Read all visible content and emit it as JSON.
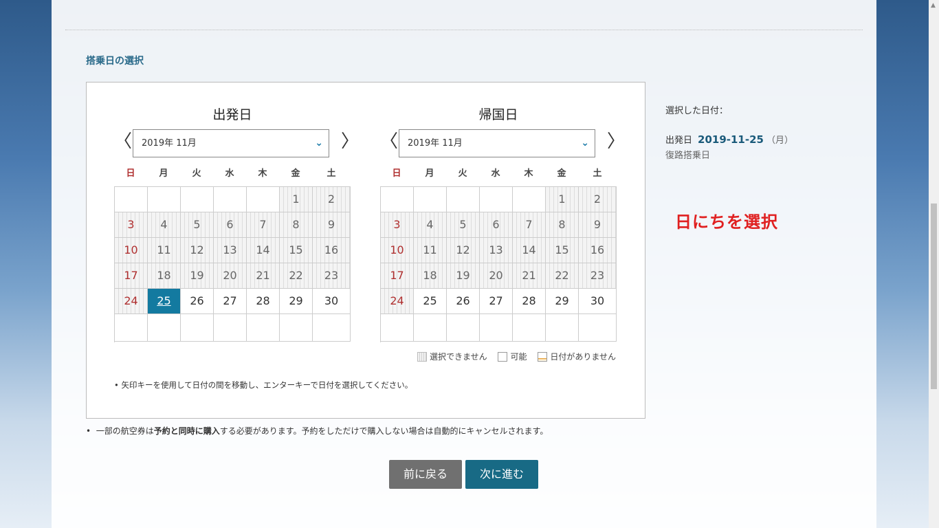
{
  "section_title": "搭乗日の選択",
  "calendars": [
    {
      "title": "出発日",
      "month_value": "2019年 11月",
      "days": [
        {
          "d": "",
          "s": "empty"
        },
        {
          "d": "",
          "s": "empty"
        },
        {
          "d": "",
          "s": "empty"
        },
        {
          "d": "",
          "s": "empty"
        },
        {
          "d": "",
          "s": "empty"
        },
        {
          "d": "1",
          "s": "na"
        },
        {
          "d": "2",
          "s": "na"
        },
        {
          "d": "3",
          "s": "na"
        },
        {
          "d": "4",
          "s": "na"
        },
        {
          "d": "5",
          "s": "na"
        },
        {
          "d": "6",
          "s": "na"
        },
        {
          "d": "7",
          "s": "na"
        },
        {
          "d": "8",
          "s": "na"
        },
        {
          "d": "9",
          "s": "na"
        },
        {
          "d": "10",
          "s": "na"
        },
        {
          "d": "11",
          "s": "na"
        },
        {
          "d": "12",
          "s": "na"
        },
        {
          "d": "13",
          "s": "na"
        },
        {
          "d": "14",
          "s": "na"
        },
        {
          "d": "15",
          "s": "na"
        },
        {
          "d": "16",
          "s": "na"
        },
        {
          "d": "17",
          "s": "na"
        },
        {
          "d": "18",
          "s": "na"
        },
        {
          "d": "19",
          "s": "na"
        },
        {
          "d": "20",
          "s": "na"
        },
        {
          "d": "21",
          "s": "na"
        },
        {
          "d": "22",
          "s": "na"
        },
        {
          "d": "23",
          "s": "na"
        },
        {
          "d": "24",
          "s": "na"
        },
        {
          "d": "25",
          "s": "selected"
        },
        {
          "d": "26",
          "s": "ok"
        },
        {
          "d": "27",
          "s": "ok"
        },
        {
          "d": "28",
          "s": "ok"
        },
        {
          "d": "29",
          "s": "ok"
        },
        {
          "d": "30",
          "s": "ok"
        },
        {
          "d": "",
          "s": "empty"
        },
        {
          "d": "",
          "s": "empty"
        },
        {
          "d": "",
          "s": "empty"
        },
        {
          "d": "",
          "s": "empty"
        },
        {
          "d": "",
          "s": "empty"
        },
        {
          "d": "",
          "s": "empty"
        },
        {
          "d": "",
          "s": "empty"
        }
      ]
    },
    {
      "title": "帰国日",
      "month_value": "2019年 11月",
      "days": [
        {
          "d": "",
          "s": "empty"
        },
        {
          "d": "",
          "s": "empty"
        },
        {
          "d": "",
          "s": "empty"
        },
        {
          "d": "",
          "s": "empty"
        },
        {
          "d": "",
          "s": "empty"
        },
        {
          "d": "1",
          "s": "na"
        },
        {
          "d": "2",
          "s": "na"
        },
        {
          "d": "3",
          "s": "na"
        },
        {
          "d": "4",
          "s": "na"
        },
        {
          "d": "5",
          "s": "na"
        },
        {
          "d": "6",
          "s": "na"
        },
        {
          "d": "7",
          "s": "na"
        },
        {
          "d": "8",
          "s": "na"
        },
        {
          "d": "9",
          "s": "na"
        },
        {
          "d": "10",
          "s": "na"
        },
        {
          "d": "11",
          "s": "na"
        },
        {
          "d": "12",
          "s": "na"
        },
        {
          "d": "13",
          "s": "na"
        },
        {
          "d": "14",
          "s": "na"
        },
        {
          "d": "15",
          "s": "na"
        },
        {
          "d": "16",
          "s": "na"
        },
        {
          "d": "17",
          "s": "na"
        },
        {
          "d": "18",
          "s": "na"
        },
        {
          "d": "19",
          "s": "na"
        },
        {
          "d": "20",
          "s": "na"
        },
        {
          "d": "21",
          "s": "na"
        },
        {
          "d": "22",
          "s": "na"
        },
        {
          "d": "23",
          "s": "na"
        },
        {
          "d": "24",
          "s": "na"
        },
        {
          "d": "25",
          "s": "ok"
        },
        {
          "d": "26",
          "s": "ok"
        },
        {
          "d": "27",
          "s": "ok"
        },
        {
          "d": "28",
          "s": "ok"
        },
        {
          "d": "29",
          "s": "ok"
        },
        {
          "d": "30",
          "s": "ok"
        },
        {
          "d": "",
          "s": "empty"
        },
        {
          "d": "",
          "s": "empty"
        },
        {
          "d": "",
          "s": "empty"
        },
        {
          "d": "",
          "s": "empty"
        },
        {
          "d": "",
          "s": "empty"
        },
        {
          "d": "",
          "s": "empty"
        },
        {
          "d": "",
          "s": "empty"
        }
      ]
    }
  ],
  "weekdays": [
    "日",
    "月",
    "火",
    "水",
    "木",
    "金",
    "土"
  ],
  "nav": {
    "prev_icon": "chevron-left-icon",
    "next_icon": "chevron-right-icon",
    "prev_glyph": "〈",
    "next_glyph": "〉"
  },
  "legend": {
    "unavailable": "選択できません",
    "available": "可能",
    "no_date": "日付がありません"
  },
  "keyboard_note": "矢印キーを使用して日付の間を移動し、エンターキーで日付を選択してください。",
  "purchase_note_prefix": "一部の航空券は",
  "purchase_note_bold": "予約と同時に購入",
  "purchase_note_suffix": "する必要があります。予約をしただけで購入しない場合は自動的にキャンセルされます。",
  "selected": {
    "label": "選択した日付：",
    "departure_label": "出発日",
    "departure_date": "2019-11-25",
    "departure_dow": "（月）",
    "return_label": "復路搭乗日"
  },
  "annotation": "日にちを選択",
  "buttons": {
    "back": "前に戻る",
    "next": "次に進む"
  },
  "colors": {
    "accent": "#137aa0",
    "button_next": "#186a85",
    "button_back": "#707070",
    "annotation": "#e02020"
  }
}
